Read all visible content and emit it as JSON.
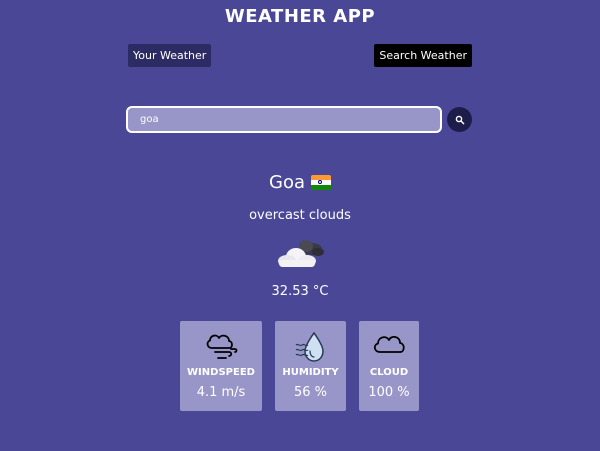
{
  "header": {
    "title": "WEATHER APP"
  },
  "tabs": {
    "your_weather": "Your Weather",
    "search_weather": "Search Weather"
  },
  "search": {
    "value": "goa",
    "button_icon": "search-icon"
  },
  "weather": {
    "city": "Goa",
    "flag_icon": "india-flag-icon",
    "description": "overcast clouds",
    "condition_icon": "overcast-clouds-icon",
    "temperature": "32.53 °C"
  },
  "stats": {
    "windspeed": {
      "label": "WINDSPEED",
      "value": "4.1 m/s",
      "icon": "wind-cloud-icon"
    },
    "humidity": {
      "label": "HUMIDITY",
      "value": "56 %",
      "icon": "humidity-drop-icon"
    },
    "cloud": {
      "label": "CLOUD",
      "value": "100 %",
      "icon": "cloud-icon"
    }
  },
  "colors": {
    "background": "#4a4896",
    "card": "#9896c8",
    "input": "#9896c8",
    "tab_active": "#000000",
    "tab_inactive": "#2d2b63"
  }
}
